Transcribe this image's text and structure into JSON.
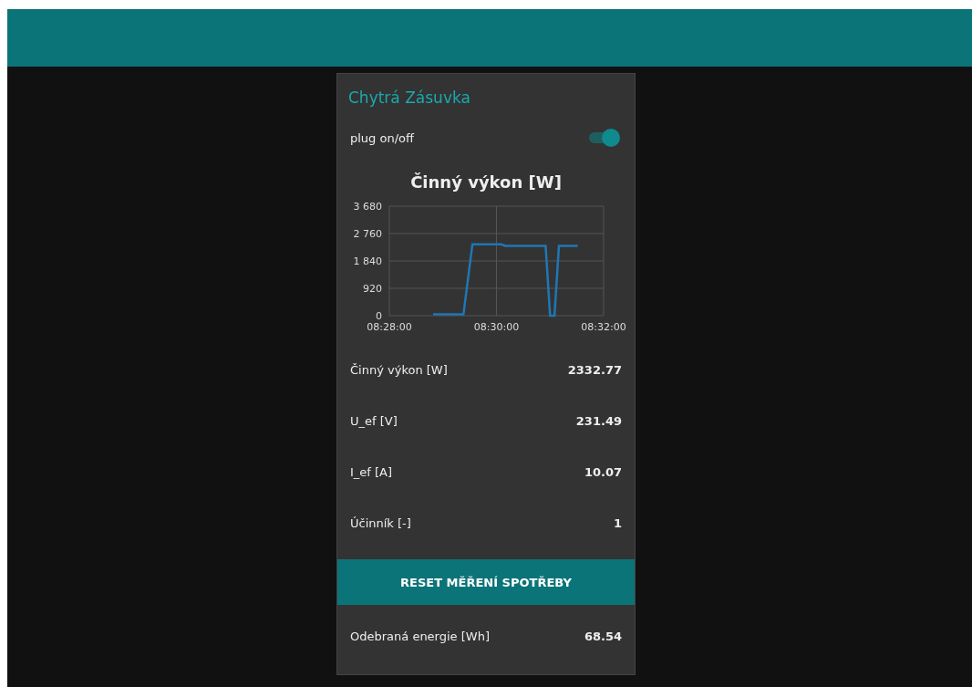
{
  "card": {
    "title": "Chytrá Zásuvka",
    "switch": {
      "label": "plug on/off",
      "on": true
    },
    "chart": {
      "chart_data": {
        "type": "line",
        "title": "Činný výkon [W]",
        "x": [
          30529,
          30540,
          30550,
          30563,
          30573,
          30580,
          30590,
          30600,
          30605,
          30610,
          30620,
          30630,
          30640,
          30655,
          30660,
          30665,
          30670,
          30680,
          30691
        ],
        "series": [
          {
            "color": "#1f77b4",
            "values": [
              50,
              50,
              50,
              50,
              2400,
              2400,
              2400,
              2400,
              2400,
              2350,
              2350,
              2350,
              2350,
              2350,
              0,
              0,
              2350,
              2350,
              2350
            ]
          }
        ],
        "grid": true,
        "xlim": [
          30480,
          30720
        ],
        "ylim": [
          0,
          3680
        ],
        "xticks": [
          {
            "value": 30480,
            "label": "08:28:00"
          },
          {
            "value": 30600,
            "label": "08:30:00"
          },
          {
            "value": 30720,
            "label": "08:32:00"
          }
        ],
        "yticks": [
          {
            "value": 0,
            "label": "0"
          },
          {
            "value": 920,
            "label": "920"
          },
          {
            "value": 1840,
            "label": "1 840"
          },
          {
            "value": 2760,
            "label": "2 760"
          },
          {
            "value": 3680,
            "label": "3 680"
          }
        ]
      }
    },
    "readings": [
      {
        "label": "Činný výkon [W]",
        "value": "2332.77"
      },
      {
        "label": "U_ef [V]",
        "value": "231.49"
      },
      {
        "label": "I_ef [A]",
        "value": "10.07"
      },
      {
        "label": "Účinník [-]",
        "value": "1"
      }
    ],
    "button": "RESET MĚŘENÍ SPOTŘEBY",
    "energy": {
      "label": "Odebraná energie [Wh]",
      "value": "68.54"
    }
  }
}
